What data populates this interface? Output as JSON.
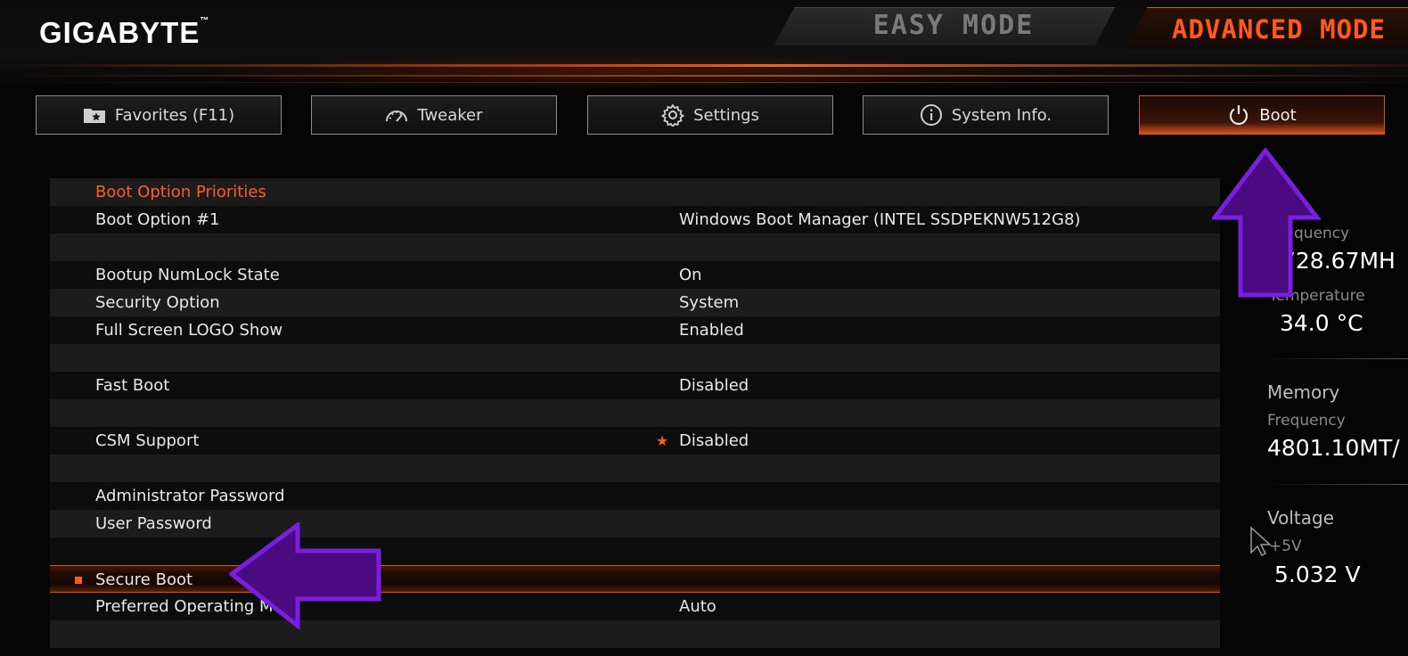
{
  "header": {
    "brand": "GIGABYTE",
    "brand_mark": "™",
    "easy_mode": "EASY MODE",
    "advanced_mode": "ADVANCED MODE"
  },
  "tabs": [
    {
      "label": "Favorites (F11)",
      "icon": "folder-star-icon"
    },
    {
      "label": "Tweaker",
      "icon": "speedometer-icon"
    },
    {
      "label": "Settings",
      "icon": "gear-icon"
    },
    {
      "label": "System Info.",
      "icon": "info-icon"
    },
    {
      "label": "Boot",
      "icon": "power-icon",
      "active": true
    }
  ],
  "menu": [
    {
      "label": "Boot Option Priorities",
      "value": ""
    },
    {
      "label": "Boot Option #1",
      "value": "Windows Boot Manager (INTEL SSDPEKNW512G8)"
    },
    {
      "label": "",
      "value": ""
    },
    {
      "label": "Bootup NumLock State",
      "value": "On"
    },
    {
      "label": "Security Option",
      "value": "System"
    },
    {
      "label": "Full Screen LOGO Show",
      "value": "Enabled"
    },
    {
      "label": "",
      "value": ""
    },
    {
      "label": "Fast Boot",
      "value": "Disabled"
    },
    {
      "label": "",
      "value": ""
    },
    {
      "label": "CSM Support",
      "value": "Disabled"
    },
    {
      "label": "",
      "value": ""
    },
    {
      "label": "Administrator Password",
      "value": ""
    },
    {
      "label": "User Password",
      "value": ""
    },
    {
      "label": "",
      "value": ""
    },
    {
      "label": "Secure Boot",
      "value": ""
    },
    {
      "label": "Preferred Operating Mo",
      "value": "Auto"
    },
    {
      "label": "",
      "value": ""
    }
  ],
  "right_panel": {
    "cpu_freq_label": "quency",
    "cpu_freq_value": "728.67MH",
    "cpu_temp_label": "Temperature",
    "cpu_temp_value": "34.0 °C",
    "memory_title": "Memory",
    "memory_freq_label": "Frequency",
    "memory_freq_value": "4801.10MT/",
    "voltage_title": "Voltage",
    "voltage_rail": "+5V",
    "voltage_value": "5.032 V"
  },
  "colors": {
    "accent": "#ff5a1e",
    "annotation_arrow": "#7a1fe0",
    "annotation_fill": "#4a0a80"
  }
}
